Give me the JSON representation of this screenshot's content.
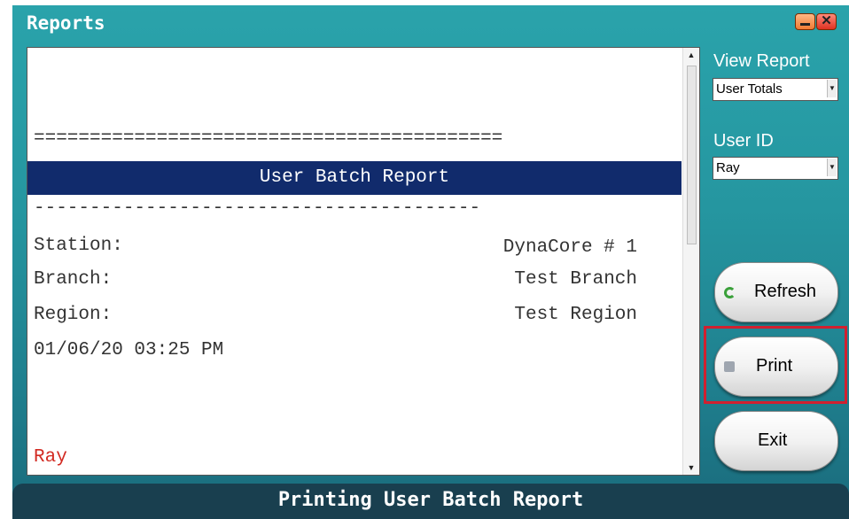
{
  "window": {
    "title": "Reports",
    "title_buttons": [
      "minimize",
      "close"
    ],
    "close_glyph": "✕"
  },
  "report": {
    "separator_double": "==========================================",
    "banner_title": "User Batch Report",
    "separator_single": "----------------------------------------",
    "rows": [
      {
        "label": "Station:",
        "value": "DynaCore # 1"
      },
      {
        "label": "Branch:",
        "value": "Test Branch"
      },
      {
        "label": "Region:",
        "value": "Test Region"
      }
    ],
    "timestamp": "01/06/20 03:25 PM",
    "user": "Ray"
  },
  "sidebar": {
    "view_report_label": "View Report",
    "view_report_value": "User Totals",
    "user_id_label": "User ID",
    "user_id_value": "Ray",
    "refresh_label": "Refresh",
    "print_label": "Print",
    "exit_label": "Exit"
  },
  "status": {
    "text": "Printing User Batch Report"
  },
  "colors": {
    "window_bg": "#2596a0",
    "banner_bg": "#112b6c",
    "status_bg": "#193f4f",
    "highlight": "#d1202f",
    "user_text": "#d22a22"
  },
  "icons": {
    "refresh": "refresh-icon",
    "print": "printer-icon",
    "scroll_up": "scroll-up-arrow-icon",
    "scroll_down": "scroll-down-arrow-icon",
    "dropdown": "dropdown-arrow-icon"
  }
}
